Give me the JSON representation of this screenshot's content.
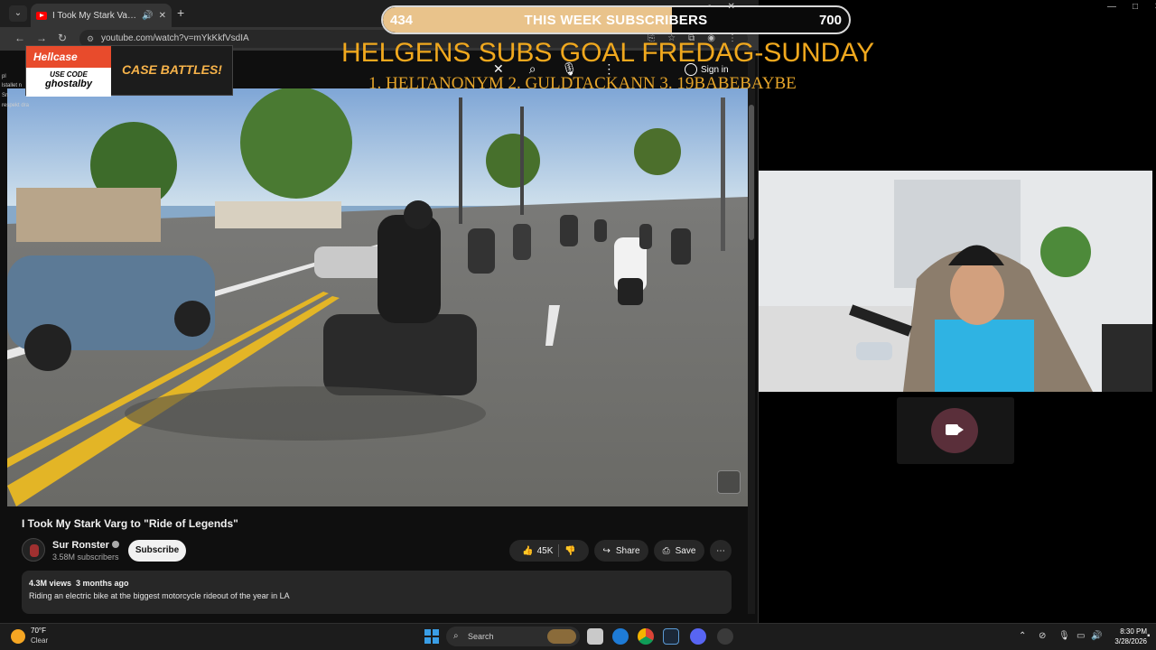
{
  "browser": {
    "tab_title": "I Took My Stark Varg to \"Ri",
    "url": "youtube.com/watch?v=mYkKkfVsdIA",
    "signin_label": "Sign in"
  },
  "video": {
    "title": "I Took My Stark Varg to \"Ride of Legends\"",
    "channel_name": "Sur Ronster",
    "subscriber_count": "3.58M subscribers",
    "subscribe_label": "Subscribe",
    "likes": "45K",
    "share_label": "Share",
    "save_label": "Save",
    "views": "4.3M views",
    "age": "3 months ago",
    "description": "Riding an electric bike at the biggest motorcycle rideout of the year in LA"
  },
  "hellcase": {
    "logo": "Hellcase",
    "use_code": "USE CODE",
    "code": "ghostalby",
    "cta": "CASE BATTLES!"
  },
  "chat": [
    {
      "text": "pl"
    },
    {
      "text": "lstallet n"
    },
    {
      "text": "Sn"
    },
    {
      "text": "respekt dra"
    }
  ],
  "sub_goal": {
    "current": 434,
    "goal": 700,
    "current_label": "434",
    "goal_label": "700",
    "label": "THIS WEEK SUBSCRIBERS",
    "title": "HELGENS SUBS GOAL FREDAG-SUNDAY",
    "names": "1. HELTANONYM  2. GULDTACKANN  3. 19BABEBAYBE"
  },
  "taskbar": {
    "temp": "70°F",
    "condition": "Clear",
    "search_placeholder": "Search",
    "time": "8:30 PM",
    "date": "3/28/2026"
  },
  "colors": {
    "goal_gold": "#f0a81e",
    "subscribe_bg": "#f1f1f1",
    "hellcase_red": "#e84b2c",
    "sub_fill": "#e9c38b"
  }
}
